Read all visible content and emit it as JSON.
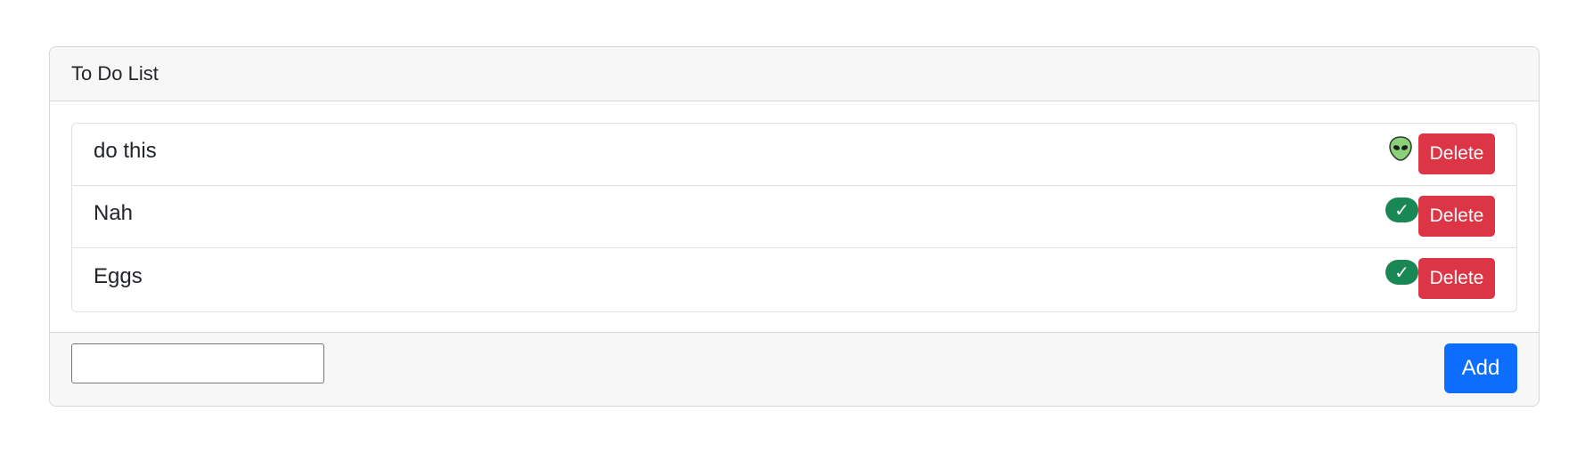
{
  "card": {
    "title": "To Do List"
  },
  "todos": [
    {
      "text": "do this",
      "status": "pending",
      "status_icon": "alien-icon",
      "delete_label": "Delete"
    },
    {
      "text": "Nah",
      "status": "done",
      "status_icon": "check-icon",
      "status_glyph": "✓",
      "delete_label": "Delete"
    },
    {
      "text": "Eggs",
      "status": "done",
      "status_icon": "check-icon",
      "status_glyph": "✓",
      "delete_label": "Delete"
    }
  ],
  "footer": {
    "input_value": "",
    "add_label": "Add"
  },
  "colors": {
    "delete": "#dc3545",
    "add": "#0d6efd",
    "done_badge": "#198754",
    "header_bg": "#f7f7f7"
  }
}
